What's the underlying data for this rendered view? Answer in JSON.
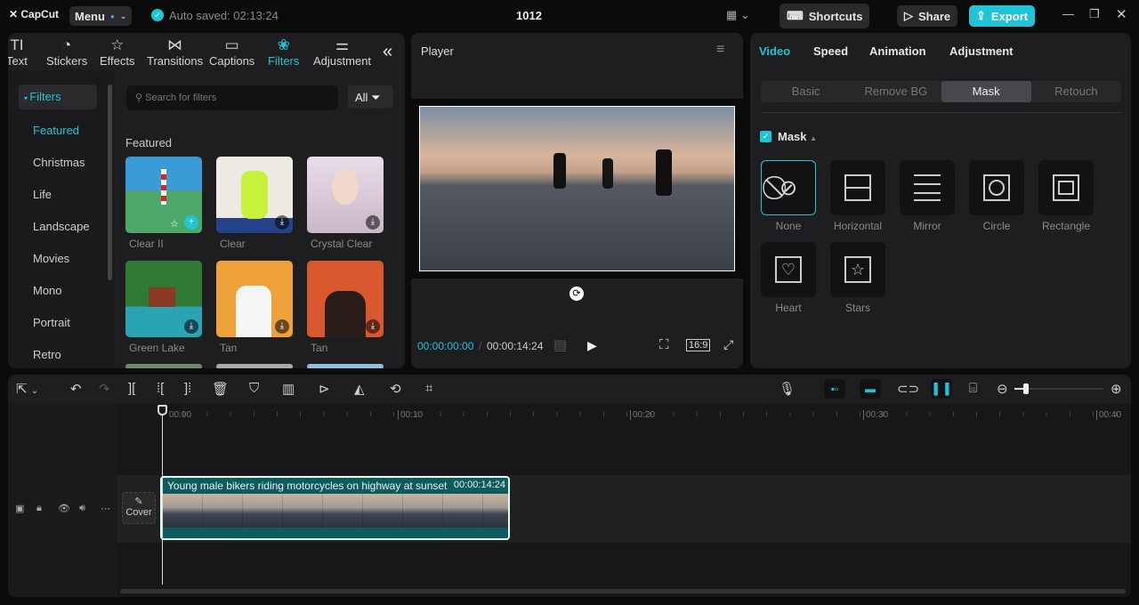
{
  "app": {
    "logo": "CapCut",
    "menu_label": "Menu",
    "autosave": "Auto saved: 02:13:24",
    "project_title": "1012",
    "shortcuts_label": "Shortcuts",
    "share_label": "Share",
    "export_label": "Export",
    "accent": "#1fc5d6"
  },
  "left_tabs": [
    {
      "label": "Text",
      "icon": "text-icon"
    },
    {
      "label": "Stickers",
      "icon": "sticker-icon"
    },
    {
      "label": "Effects",
      "icon": "effects-icon"
    },
    {
      "label": "Transitions",
      "icon": "transitions-icon"
    },
    {
      "label": "Captions",
      "icon": "captions-icon"
    },
    {
      "label": "Filters",
      "icon": "filters-icon"
    },
    {
      "label": "Adjustment",
      "icon": "adjustment-icon"
    }
  ],
  "filters": {
    "section": "Filters",
    "categories": [
      "Featured",
      "Christmas",
      "Life",
      "Landscape",
      "Movies",
      "Mono",
      "Portrait",
      "Retro"
    ],
    "search_placeholder": "Search for filters",
    "all_label": "All",
    "featured_heading": "Featured",
    "items": [
      "Clear II",
      "Clear",
      "Crystal Clear",
      "Green Lake",
      "Tan",
      "Tan"
    ]
  },
  "player": {
    "title": "Player",
    "current_time": "00:00:00:00",
    "duration": "00:00:14:24",
    "ratio": "16:9"
  },
  "right": {
    "tabs": [
      "Video",
      "Speed",
      "Animation",
      "Adjustment"
    ],
    "subtabs": [
      "Basic",
      "Remove BG",
      "Mask",
      "Retouch"
    ],
    "mask_label": "Mask",
    "masks": [
      "None",
      "Horizontal",
      "Mirror",
      "Circle",
      "Rectangle",
      "Heart",
      "Stars"
    ]
  },
  "timeline": {
    "ticks": [
      "00:00",
      "00:10",
      "00:20",
      "00:30",
      "00:40"
    ],
    "clip_title": "Young male bikers riding motorcycles on highway at sunset",
    "clip_duration": "00:00:14:24",
    "cover_label": "Cover"
  }
}
